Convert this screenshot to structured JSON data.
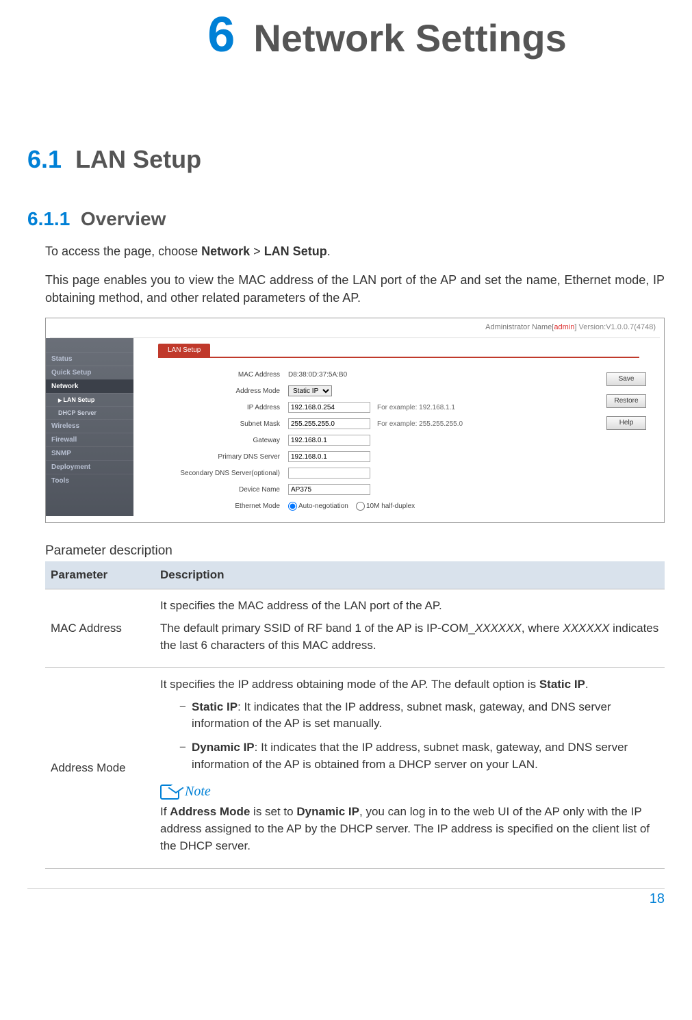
{
  "chapter": {
    "number": "6",
    "title": "Network Settings"
  },
  "section_6_1": {
    "number": "6.1",
    "title": "LAN Setup"
  },
  "section_6_1_1": {
    "number": "6.1.1",
    "title": "Overview"
  },
  "intro": {
    "access_prefix": "To access the page, choose ",
    "nav1": "Network",
    "sep": " > ",
    "nav2": "LAN Setup",
    "period": ".",
    "para2": "This page enables you to view the MAC address of the LAN port of the AP and set the name, Ethernet mode, IP obtaining method, and other related parameters of the AP."
  },
  "screenshot": {
    "topbar": {
      "admin_label": "Administrator Name[",
      "admin_name": "admin",
      "admin_close": "]",
      "version": "Version:V1.0.0.7(4748)"
    },
    "sidebar": {
      "items": [
        {
          "label": "Status"
        },
        {
          "label": "Quick Setup"
        },
        {
          "label": "Network",
          "selected": true,
          "subs": [
            {
              "label": "LAN Setup",
              "active": true
            },
            {
              "label": "DHCP Server"
            }
          ]
        },
        {
          "label": "Wireless"
        },
        {
          "label": "Firewall"
        },
        {
          "label": "SNMP"
        },
        {
          "label": "Deployment"
        },
        {
          "label": "Tools"
        }
      ]
    },
    "tab": "LAN Setup",
    "form": {
      "mac_label": "MAC Address",
      "mac_value": "D8:38:0D:37:5A:B0",
      "addr_mode_label": "Address Mode",
      "addr_mode_value": "Static IP",
      "ip_label": "IP Address",
      "ip_value": "192.168.0.254",
      "ip_hint": "For example: 192.168.1.1",
      "mask_label": "Subnet Mask",
      "mask_value": "255.255.255.0",
      "mask_hint": "For example: 255.255.255.0",
      "gw_label": "Gateway",
      "gw_value": "192.168.0.1",
      "dns1_label": "Primary DNS Server",
      "dns1_value": "192.168.0.1",
      "dns2_label": "Secondary DNS Server(optional)",
      "dns2_value": "",
      "devname_label": "Device Name",
      "devname_value": "AP375",
      "eth_label": "Ethernet Mode",
      "eth_opt1": "Auto-negotiation",
      "eth_opt2": "10M half-duplex"
    },
    "buttons": {
      "save": "Save",
      "restore": "Restore",
      "help": "Help"
    }
  },
  "param_table": {
    "caption": "Parameter description",
    "headers": {
      "param": "Parameter",
      "desc": "Description"
    },
    "rows": {
      "mac": {
        "name": "MAC Address",
        "p1": "It specifies the MAC address of the LAN port of the AP.",
        "p2a": "The default primary SSID of RF band 1 of the AP is IP-COM_",
        "p2x": "XXXXXX",
        "p2b": ", where ",
        "p2y": "XXXXXX",
        "p2c": " indicates the last 6 characters of this MAC address."
      },
      "addr": {
        "name": "Address Mode",
        "p1a": "It specifies the IP address obtaining mode of the AP. The default option is ",
        "p1b": "Static IP",
        "p1c": ".",
        "li1a": "Static IP",
        "li1b": ": It indicates that the IP address, subnet mask, gateway, and DNS server information of the AP is set manually.",
        "li2a": "Dynamic IP",
        "li2b": ": It indicates that the IP address, subnet mask, gateway, and DNS server information of the AP is obtained from a DHCP server on your LAN.",
        "note_label": "Note",
        "note_a": "If ",
        "note_b": "Address Mode",
        "note_c": " is set to ",
        "note_d": "Dynamic IP",
        "note_e": ", you can log in to the web UI of the AP only with the IP address assigned to the AP by the DHCP server. The IP address is specified on the client list of the DHCP server."
      }
    }
  },
  "page_number": "18"
}
